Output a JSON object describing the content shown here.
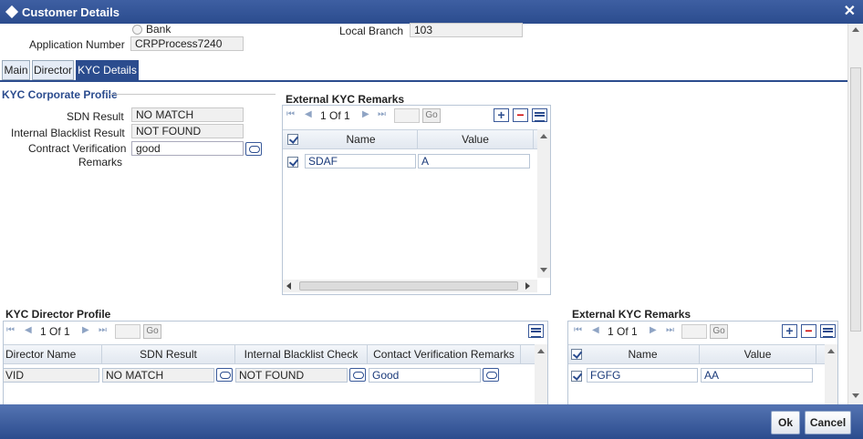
{
  "window": {
    "title": "Customer Details",
    "close": "✕"
  },
  "top": {
    "bank_label": "Bank",
    "application_number_label": "Application Number",
    "application_number_value": "CRPProcess7240",
    "local_branch_label": "Local Branch",
    "local_branch_value": "103"
  },
  "tabs": [
    {
      "label": "Main"
    },
    {
      "label": "Director"
    },
    {
      "label": "KYC Details"
    }
  ],
  "kyc_corporate": {
    "title": "KYC Corporate Profile",
    "sdn_label": "SDN Result",
    "sdn_value": "NO MATCH",
    "blacklist_label": "Internal Blacklist Result",
    "blacklist_value": "NOT FOUND",
    "contract_label_1": "Contract Verification",
    "contract_label_2": "Remarks",
    "contract_value": "good"
  },
  "ext_kyc_1": {
    "title": "External KYC Remarks",
    "page_text": "1 Of 1",
    "go": "Go",
    "columns": [
      "Name",
      "Value"
    ],
    "rows": [
      {
        "name": "SDAF",
        "value": "A"
      }
    ]
  },
  "kyc_director": {
    "title": "KYC Director Profile",
    "page_text": "1 Of 1",
    "go": "Go",
    "columns": [
      "Director Name",
      "SDN Result",
      "Internal Blacklist Check",
      "Contact Verification Remarks"
    ],
    "rows": [
      {
        "director": "VID",
        "sdn": "NO MATCH",
        "blacklist": "NOT FOUND",
        "remarks": "Good"
      }
    ]
  },
  "ext_kyc_2": {
    "title": "External KYC Remarks",
    "page_text": "1 Of 1",
    "go": "Go",
    "columns": [
      "Name",
      "Value"
    ],
    "rows": [
      {
        "name": "FGFG",
        "value": "AA"
      }
    ]
  },
  "footer": {
    "ok": "Ok",
    "cancel": "Cancel"
  },
  "icons": {
    "first": "⏮",
    "prev": "◀",
    "next": "▶",
    "last": "⏭",
    "add": "+",
    "delete": "−"
  }
}
